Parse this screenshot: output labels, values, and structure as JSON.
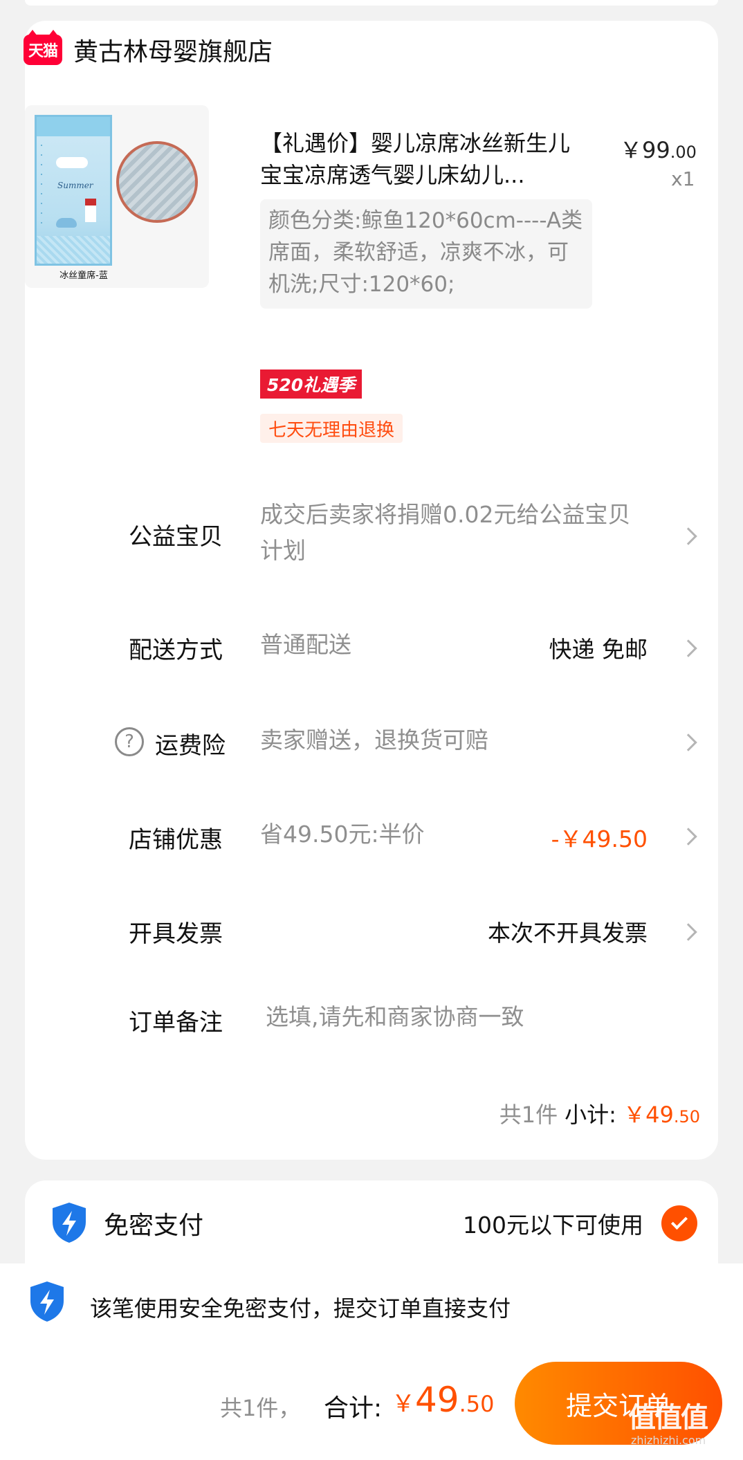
{
  "shop": {
    "badge": "天猫",
    "name": "黄古林母婴旗舰店"
  },
  "product": {
    "image_caption": "冰丝童席-蓝",
    "image_text": "Summer",
    "title": "【礼遇价】婴儿凉席冰丝新生儿宝宝凉席透气婴儿床幼儿...",
    "price_int": "￥99",
    "price_dec": ".00",
    "qty": "x1",
    "sku": "颜色分类:鲸鱼120*60cm----A类席面，柔软舒适，凉爽不冰，可机洗;尺寸:120*60;",
    "promo_tag": "520礼遇季",
    "return_tag": "七天无理由退换"
  },
  "rows": {
    "charity": {
      "label": "公益宝贝",
      "value": "成交后卖家将捐赠0.02元给公益宝贝计划"
    },
    "delivery": {
      "label": "配送方式",
      "value": "普通配送",
      "right": "快递 免邮"
    },
    "shipping_insurance": {
      "label": "运费险",
      "value": "卖家赠送，退换货可赔",
      "icon": "?"
    },
    "store_discount": {
      "label": "店铺优惠",
      "value": "省49.50元:半价",
      "right": "-￥49.50"
    },
    "invoice": {
      "label": "开具发票",
      "right": "本次不开具发票"
    },
    "remark": {
      "label": "订单备注",
      "placeholder": "选填,请先和商家协商一致"
    }
  },
  "subtotal": {
    "count": "共1件",
    "label": "小计:",
    "amount_int": "￥49",
    "amount_dec": ".50"
  },
  "payment": {
    "title": "免密支付",
    "limit": "100元以下可使用",
    "note": "该笔使用安全免密支付，提交订单直接支付"
  },
  "footer": {
    "count": "共1件，",
    "total_label": "合计:",
    "currency": "￥",
    "total_int": "49",
    "total_dec": ".50",
    "submit_label": "提交订单"
  },
  "watermark": {
    "brand": "值值值",
    "url": "zhizhizhi.com"
  },
  "colors": {
    "accent": "#ff5000",
    "tmall": "#ff0036",
    "shield": "#1e78e8",
    "promo": "#e91a33"
  }
}
